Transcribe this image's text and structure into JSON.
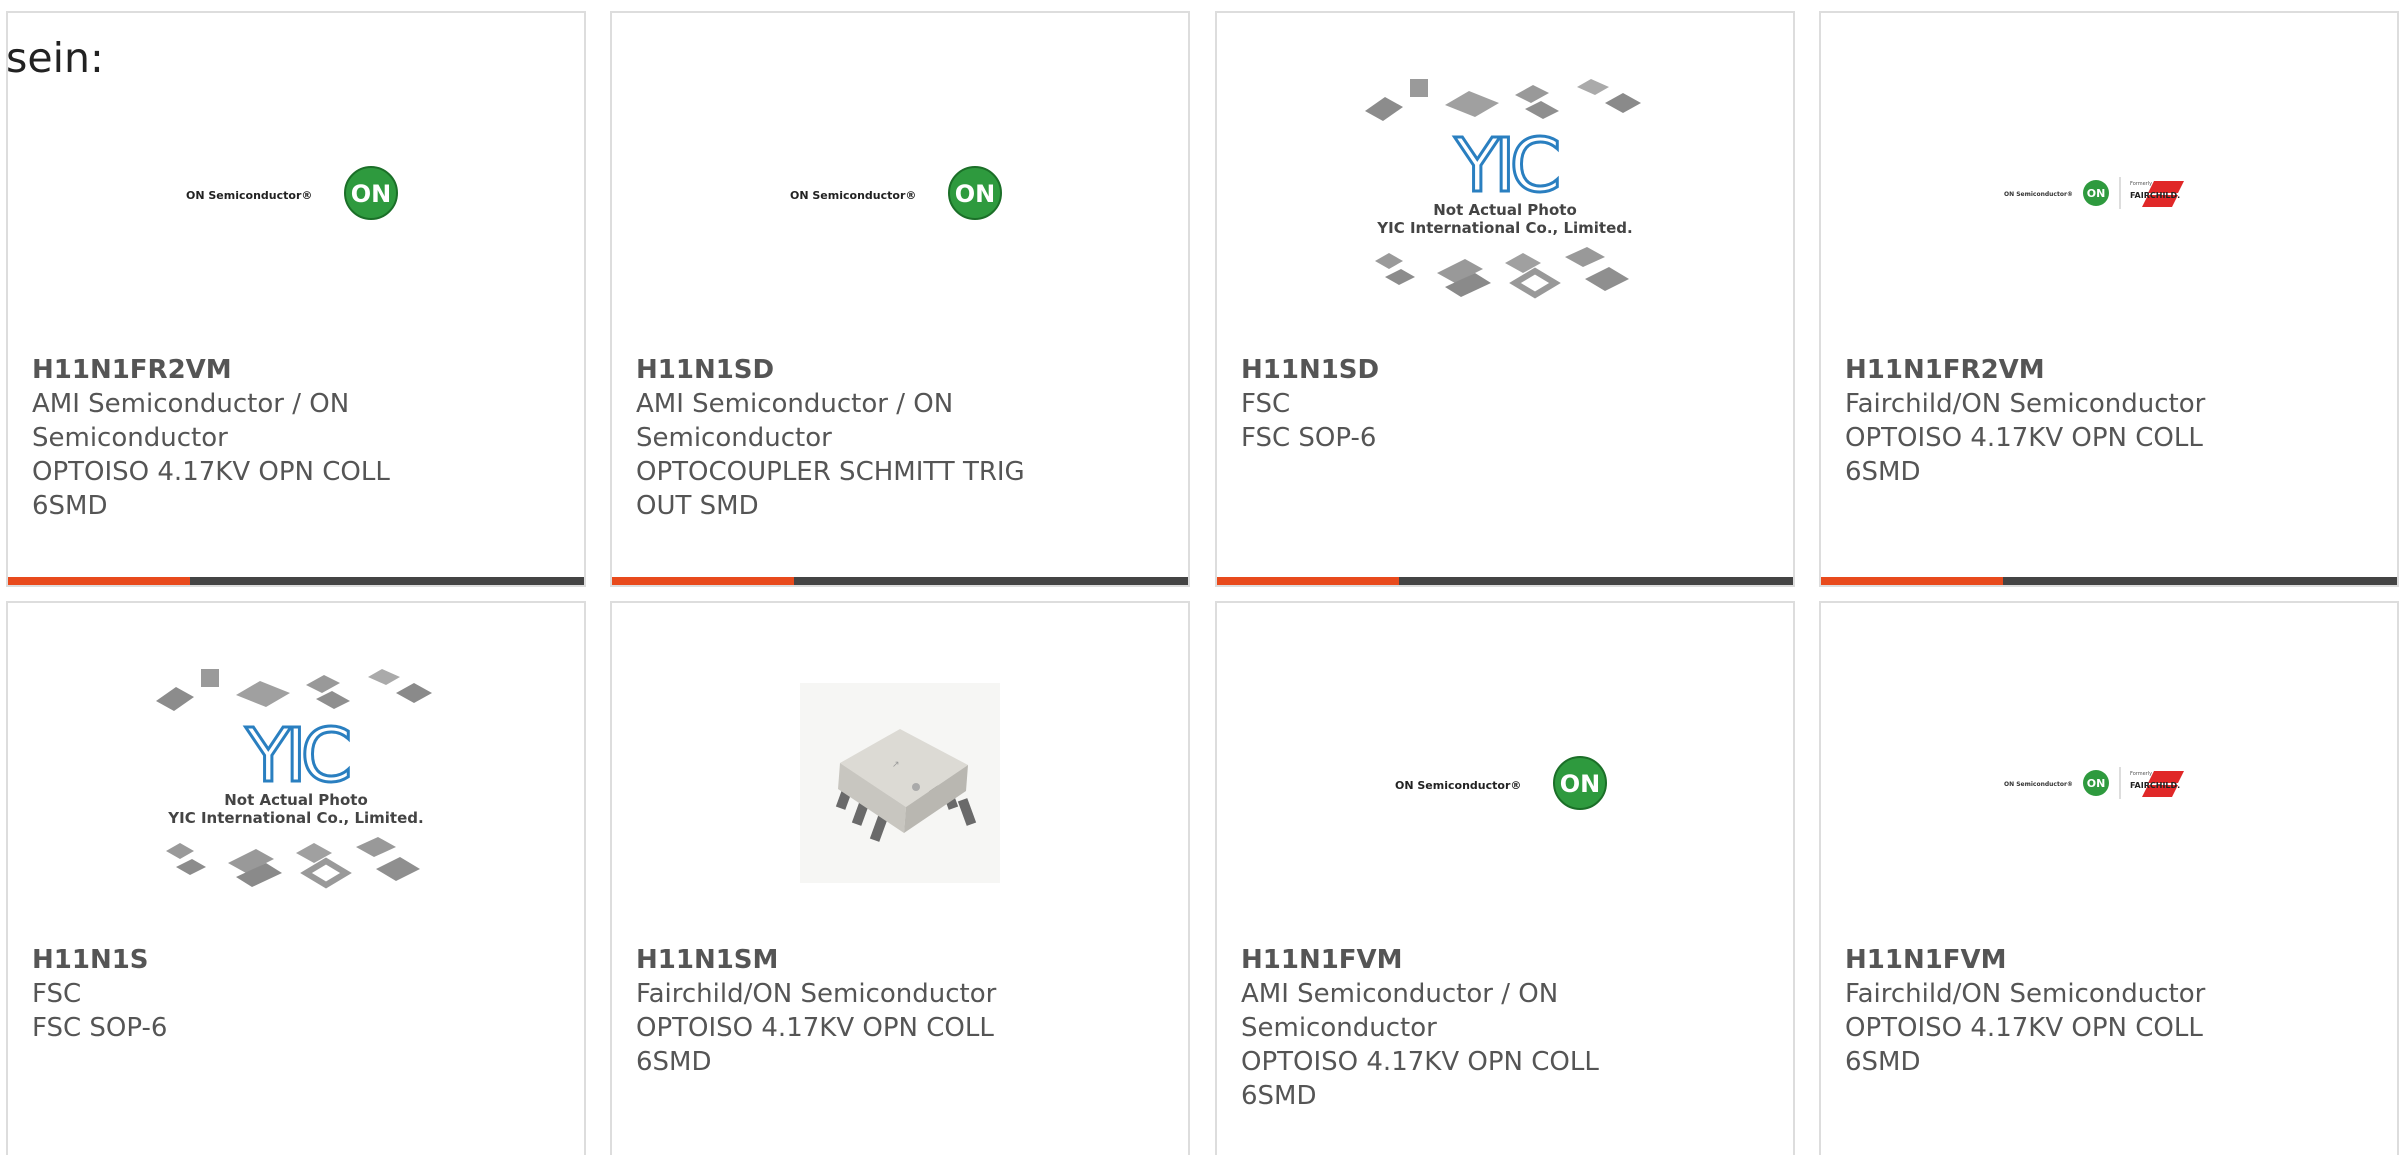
{
  "intro_text": "sein:",
  "colors": {
    "accent": "#e84a1c",
    "bar": "#444444",
    "text": "#555555",
    "border": "#dddddd"
  },
  "cards": [
    {
      "part_number": "H11N1FR2VM",
      "manufacturer": "AMI Semiconductor / ON\nSemiconductor",
      "description": "OPTOISO 4.17KV OPN COLL\n6SMD",
      "image": "on-semiconductor-logo"
    },
    {
      "part_number": "H11N1SD",
      "manufacturer": "AMI Semiconductor / ON\nSemiconductor",
      "description": "OPTOCOUPLER SCHMITT TRIG\nOUT SMD",
      "image": "on-semiconductor-logo"
    },
    {
      "part_number": "H11N1SD",
      "manufacturer": "FSC",
      "description": "FSC SOP-6",
      "image": "yic-placeholder",
      "placeholder_line1": "Not Actual Photo",
      "placeholder_line2": "YIC International Co., Limited."
    },
    {
      "part_number": "H11N1FR2VM",
      "manufacturer": "Fairchild/ON Semiconductor",
      "description": "OPTOISO 4.17KV OPN COLL\n6SMD",
      "image": "on-fairchild-logo"
    },
    {
      "part_number": "H11N1S",
      "manufacturer": "FSC",
      "description": "FSC SOP-6",
      "image": "yic-placeholder",
      "placeholder_line1": "Not Actual Photo",
      "placeholder_line2": "YIC International Co., Limited."
    },
    {
      "part_number": "H11N1SM",
      "manufacturer": "Fairchild/ON Semiconductor",
      "description": "OPTOISO 4.17KV OPN COLL\n6SMD",
      "image": "chip-photo"
    },
    {
      "part_number": "H11N1FVM",
      "manufacturer": "AMI Semiconductor / ON\nSemiconductor",
      "description": "OPTOISO 4.17KV OPN COLL\n6SMD",
      "image": "on-semiconductor-logo"
    },
    {
      "part_number": "H11N1FVM",
      "manufacturer": "Fairchild/ON Semiconductor",
      "description": "OPTOISO 4.17KV OPN COLL\n6SMD",
      "image": "on-fairchild-logo"
    }
  ],
  "logos": {
    "on_semi_text": "ON Semiconductor®",
    "on_badge": "ON",
    "formerly": "Formerly",
    "fairchild": "FAIRCHILD."
  }
}
